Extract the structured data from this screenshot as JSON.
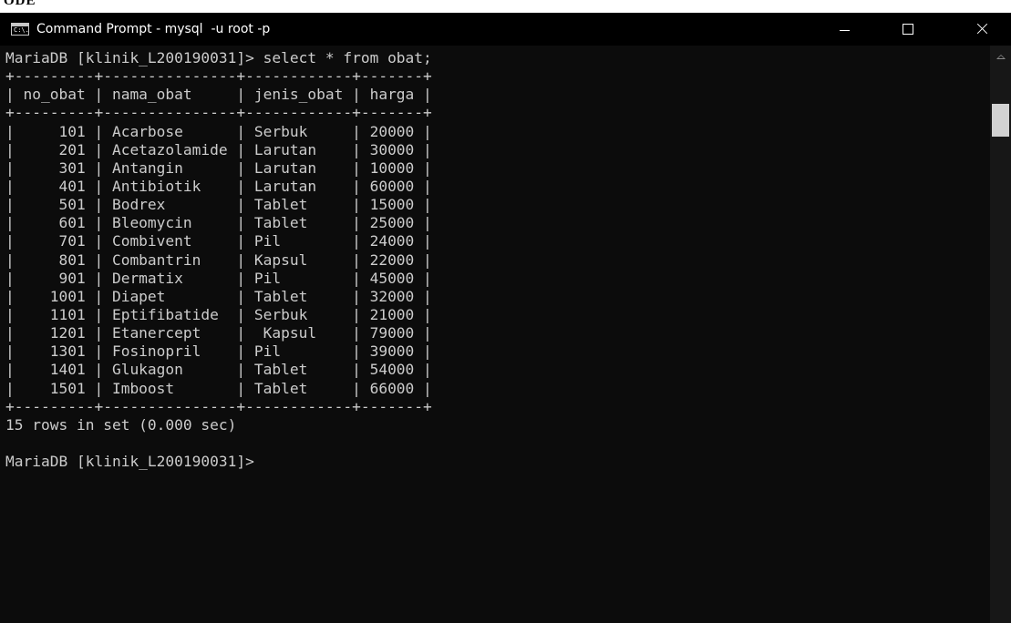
{
  "header_fragment": "ODE",
  "window": {
    "title": "Command Prompt - mysql  -u root -p",
    "icon": "console-app-icon",
    "icon_glyph": "C:\\.",
    "controls": {
      "minimize": "minimize-icon",
      "maximize": "maximize-icon",
      "close": "close-icon"
    }
  },
  "console": {
    "lines": [
      "MariaDB [klinik_L200190031]> select * from obat;",
      "+---------+---------------+------------+-------+",
      "| no_obat | nama_obat     | jenis_obat | harga |",
      "+---------+---------------+------------+-------+",
      "|     101 | Acarbose      | Serbuk     | 20000 |",
      "|     201 | Acetazolamide | Larutan    | 30000 |",
      "|     301 | Antangin      | Larutan    | 10000 |",
      "|     401 | Antibiotik    | Larutan    | 60000 |",
      "|     501 | Bodrex        | Tablet     | 15000 |",
      "|     601 | Bleomycin     | Tablet     | 25000 |",
      "|     701 | Combivent     | Pil        | 24000 |",
      "|     801 | Combantrin    | Kapsul     | 22000 |",
      "|     901 | Dermatix      | Pil        | 45000 |",
      "|    1001 | Diapet        | Tablet     | 32000 |",
      "|    1101 | Eptifibatide  | Serbuk     | 21000 |",
      "|    1201 | Etanercept    |  Kapsul    | 79000 |",
      "|    1301 | Fosinopril    | Pil        | 39000 |",
      "|    1401 | Glukagon      | Tablet     | 54000 |",
      "|    1501 | Imboost       | Tablet     | 66000 |",
      "+---------+---------------+------------+-------+",
      "15 rows in set (0.000 sec)",
      "",
      "MariaDB [klinik_L200190031]>"
    ]
  },
  "colors": {
    "console_background": "#0c0c0c",
    "console_text": "#cccccc",
    "titlebar_background": "#000000",
    "scrollbar_thumb": "#d2d2d2"
  }
}
